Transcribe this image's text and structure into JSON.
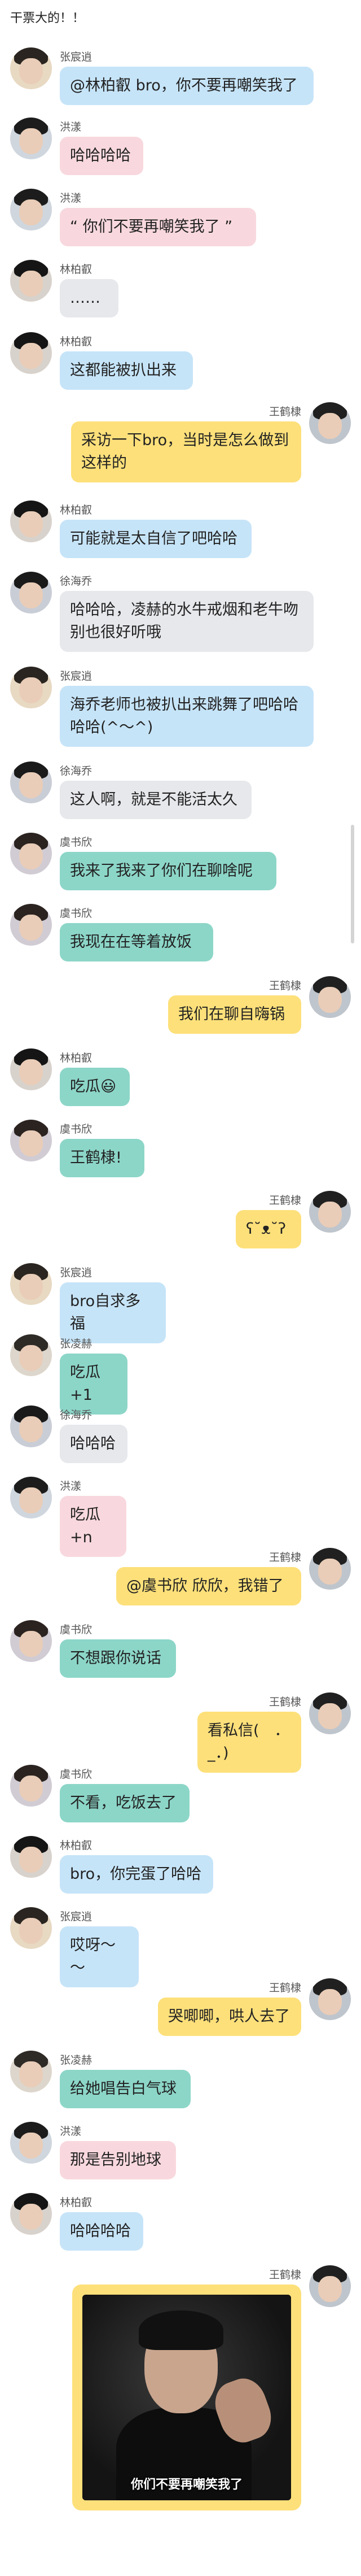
{
  "header": {
    "title": "干票大的！！"
  },
  "colors": {
    "blue": "#c6e4f8",
    "pink": "#f8d8de",
    "gray": "#e7e8ec",
    "teal": "#8cd6c8",
    "yellow": "#fde07a"
  },
  "messages": [
    {
      "name": "张宸逍",
      "text": "@林柏叡 bro，你不要再嘲笑我了"
    },
    {
      "name": "洪漾",
      "text": "哈哈哈哈"
    },
    {
      "name": "洪漾",
      "text": "“ 你们不要再嘲笑我了 ”"
    },
    {
      "name": "林柏叡",
      "text": "……"
    },
    {
      "name": "林柏叡",
      "text": "这都能被扒出来"
    },
    {
      "name": "王鹤棣",
      "text": "采访一下bro，当时是怎么做到这样的"
    },
    {
      "name": "林柏叡",
      "text": "可能就是太自信了吧哈哈"
    },
    {
      "name": "徐海乔",
      "text": "哈哈哈，凌赫的水牛戒烟和老牛吻别也很好听哦"
    },
    {
      "name": "张宸逍",
      "text": "海乔老师也被扒出来跳舞了吧哈哈哈哈(^～^)"
    },
    {
      "name": "徐海乔",
      "text": "这人啊，就是不能活太久"
    },
    {
      "name": "虞书欣",
      "text": "我来了我来了你们在聊啥呢"
    },
    {
      "name": "虞书欣",
      "text": "我现在在等着放饭"
    },
    {
      "name": "王鹤棣",
      "text": "我们在聊自嗨锅"
    },
    {
      "name": "林柏叡",
      "text": "吃瓜😃"
    },
    {
      "name": "虞书欣",
      "text": "王鹤棣!"
    },
    {
      "name": "王鹤棣",
      "text": "ʕ˘ᴥ˘ʔ"
    },
    {
      "name": "张宸逍",
      "text": "bro自求多福"
    },
    {
      "name": "张凌赫",
      "text": "吃瓜+1"
    },
    {
      "name": "徐海乔",
      "text": "哈哈哈"
    },
    {
      "name": "洪漾",
      "text": "吃瓜+n"
    },
    {
      "name": "王鹤棣",
      "text": "@虞书欣 欣欣，我错了"
    },
    {
      "name": "虞书欣",
      "text": "不想跟你说话"
    },
    {
      "name": "王鹤棣",
      "text": "看私信(　．_．)"
    },
    {
      "name": "虞书欣",
      "text": "不看，吃饭去了"
    },
    {
      "name": "林柏叡",
      "text": "bro，你完蛋了哈哈"
    },
    {
      "name": "张宸逍",
      "text": "哎呀～～"
    },
    {
      "name": "王鹤棣",
      "text": "哭唧唧，哄人去了"
    },
    {
      "name": "张凌赫",
      "text": "给她唱告白气球"
    },
    {
      "name": "洪漾",
      "text": "那是告别地球"
    },
    {
      "name": "林柏叡",
      "text": "哈哈哈哈"
    },
    {
      "name": "王鹤棣",
      "image_caption": "你们不要再嘲笑我了"
    }
  ]
}
